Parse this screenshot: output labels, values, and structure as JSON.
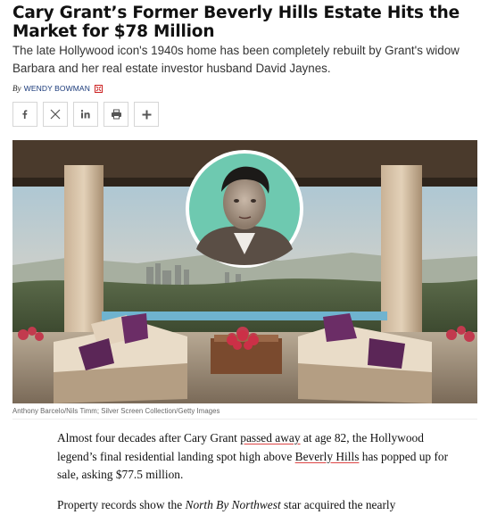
{
  "article": {
    "headline": "Cary Grant’s Former Beverly Hills Estate Hits the Market for $78 Million",
    "dek": "The late Hollywood icon's 1940s home has been completely rebuilt by Grant's widow Barbara and her real estate investor husband David Jaynes.",
    "byline": {
      "prefix": "By",
      "author": "Wendy Bowman"
    },
    "share": [
      {
        "name": "facebook-share-button",
        "icon": "facebook-icon"
      },
      {
        "name": "x-share-button",
        "icon": "x-icon"
      },
      {
        "name": "linkedin-share-button",
        "icon": "linkedin-icon"
      },
      {
        "name": "print-button",
        "icon": "print-icon"
      },
      {
        "name": "more-share-button",
        "icon": "plus-icon"
      }
    ],
    "photo_caption": "Anthony Barcelo/Nils Timm; Silver Screen Collection/Getty Images",
    "paragraph1": {
      "a": "Almost four decades after Cary Grant ",
      "link1": "passed away",
      "b": " at age 82, the Hollywood legend’s final residential landing spot high above ",
      "link2": "Beverly Hills",
      "c": " has popped up for sale, asking $77.5 million."
    },
    "paragraph2": {
      "a": "Property records show the ",
      "title": "North By Northwest",
      "b": " star acquired the nearly"
    }
  },
  "colors": {
    "link_underline": "#dd4444",
    "byline_author": "#1a3a7a",
    "author_icon": "#cc2222"
  }
}
